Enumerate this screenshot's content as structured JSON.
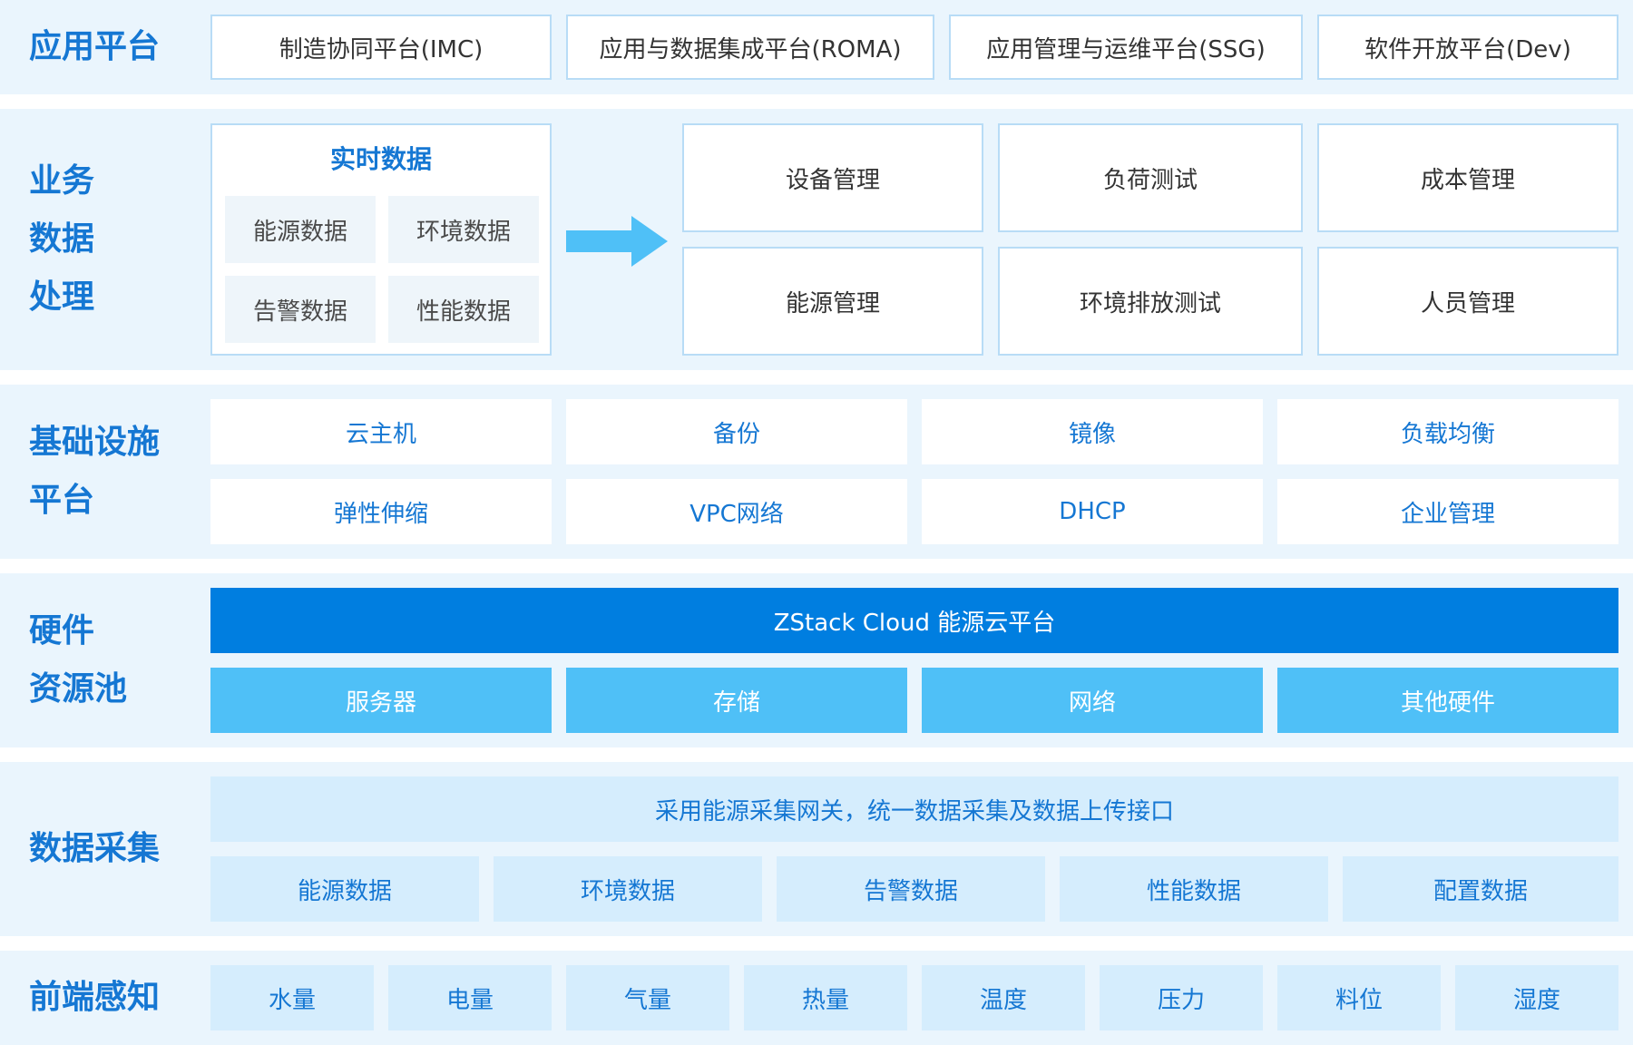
{
  "layers": {
    "app": {
      "label": [
        "应用平台"
      ],
      "items": [
        "制造协同平台(IMC)",
        "应用与数据集成平台(ROMA)",
        "应用管理与运维平台(SSG)",
        "软件开放平台(Dev)"
      ]
    },
    "business": {
      "label": [
        "业务",
        "数据",
        "处理"
      ],
      "realtime_title": "实时数据",
      "realtime_items": [
        "能源数据",
        "环境数据",
        "告警数据",
        "性能数据"
      ],
      "arrow_icon": "right-arrow-icon",
      "management_items": [
        "设备管理",
        "负荷测试",
        "成本管理",
        "能源管理",
        "环境排放测试",
        "人员管理"
      ]
    },
    "infra": {
      "label": [
        "基础设施",
        "平台"
      ],
      "items": [
        "云主机",
        "备份",
        "镜像",
        "负载均衡",
        "弹性伸缩",
        "VPC网络",
        "DHCP",
        "企业管理"
      ]
    },
    "hardware": {
      "label": [
        "硬件",
        "资源池"
      ],
      "platform": "ZStack Cloud 能源云平台",
      "items": [
        "服务器",
        "存储",
        "网络",
        "其他硬件"
      ]
    },
    "collect": {
      "label": [
        "数据采集"
      ],
      "banner": "采用能源采集网关，统一数据采集及数据上传接口",
      "items": [
        "能源数据",
        "环境数据",
        "告警数据",
        "性能数据",
        "配置数据"
      ]
    },
    "sensing": {
      "label": [
        "前端感知"
      ],
      "items": [
        "水量",
        "电量",
        "气量",
        "热量",
        "温度",
        "压力",
        "料位",
        "湿度"
      ]
    }
  },
  "colors": {
    "row_bg": "#eaf5fd",
    "accent": "#1577d3",
    "platform_bar": "#007ee0",
    "hardware_box": "#4fc0f7",
    "collect_box": "#d5edfd",
    "border": "#b8dcf6",
    "arrow": "#4fc0f7"
  }
}
